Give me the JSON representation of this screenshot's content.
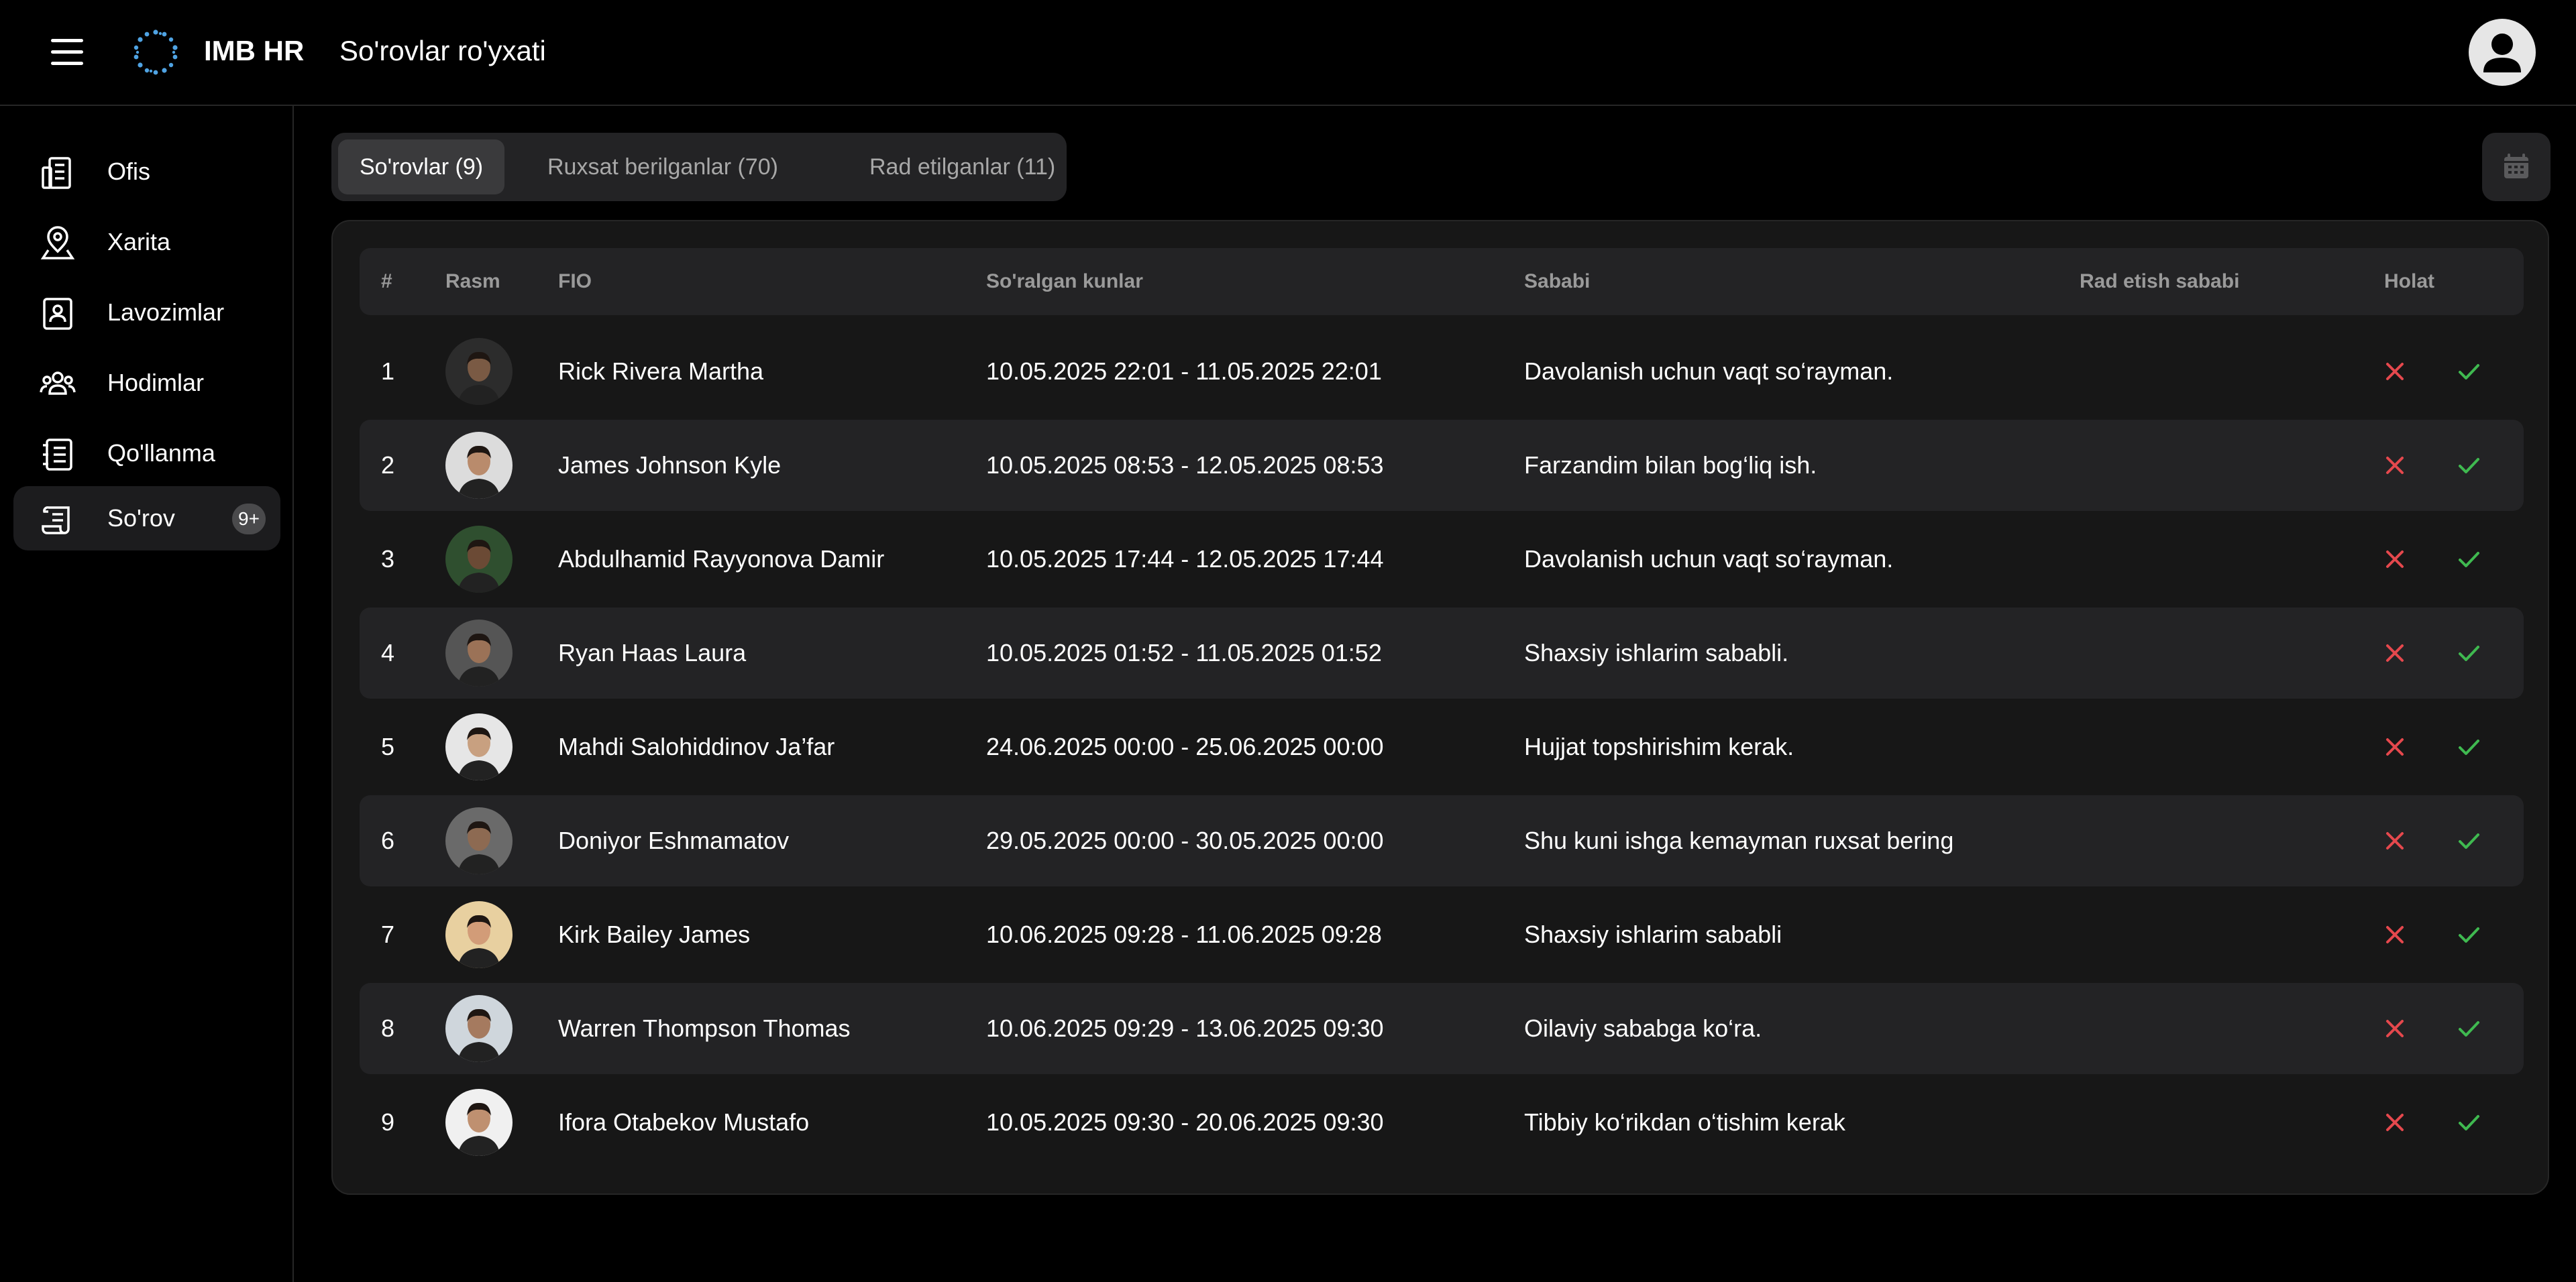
{
  "header": {
    "brand": "IMB HR",
    "title": "So'rovlar ro'yxati"
  },
  "sidebar": {
    "items": [
      {
        "label": "Ofis",
        "icon": "office-building-icon"
      },
      {
        "label": "Xarita",
        "icon": "map-pin-icon"
      },
      {
        "label": "Lavozimlar",
        "icon": "id-badge-icon"
      },
      {
        "label": "Hodimlar",
        "icon": "people-icon"
      },
      {
        "label": "Qo'llanma",
        "icon": "notebook-icon"
      },
      {
        "label": "So'rov",
        "icon": "scroll-icon",
        "badge": "9+",
        "active": true
      }
    ]
  },
  "tabs": [
    {
      "label": "So'rovlar (9)",
      "active": true
    },
    {
      "label": "Ruxsat berilganlar (70)",
      "active": false
    },
    {
      "label": "Rad etilganlar (11)",
      "active": false
    }
  ],
  "table": {
    "columns": {
      "num": "#",
      "photo": "Rasm",
      "name": "FIO",
      "dates": "So'ralgan kunlar",
      "reason": "Sababi",
      "reject_reason": "Rad etish sababi",
      "status": "Holat"
    },
    "rows": [
      {
        "num": "1",
        "name": "Rick Rivera Martha",
        "dates": "10.05.2025 22:01 - 11.05.2025 22:01",
        "reason": "Davolanish uchun vaqt so‘rayman.",
        "reject_reason": ""
      },
      {
        "num": "2",
        "name": "James Johnson Kyle",
        "dates": "10.05.2025 08:53 - 12.05.2025 08:53",
        "reason": "Farzandim bilan bog‘liq ish.",
        "reject_reason": ""
      },
      {
        "num": "3",
        "name": "Abdulhamid Rayyonova Damir",
        "dates": "10.05.2025 17:44 - 12.05.2025 17:44",
        "reason": "Davolanish uchun vaqt so‘rayman.",
        "reject_reason": ""
      },
      {
        "num": "4",
        "name": "Ryan Haas Laura",
        "dates": "10.05.2025 01:52 - 11.05.2025 01:52",
        "reason": "Shaxsiy ishlarim sababli.",
        "reject_reason": ""
      },
      {
        "num": "5",
        "name": "Mahdi Salohiddinov Ja’far",
        "dates": "24.06.2025 00:00 - 25.06.2025 00:00",
        "reason": "Hujjat topshirishim kerak.",
        "reject_reason": ""
      },
      {
        "num": "6",
        "name": "Doniyor Eshmamatov",
        "dates": "29.05.2025 00:00 - 30.05.2025 00:00",
        "reason": "Shu kuni ishga kemayman ruxsat bering",
        "reject_reason": ""
      },
      {
        "num": "7",
        "name": "Kirk Bailey James",
        "dates": "10.06.2025 09:28 - 11.06.2025 09:28",
        "reason": "Shaxsiy ishlarim sababli",
        "reject_reason": ""
      },
      {
        "num": "8",
        "name": "Warren Thompson Thomas",
        "dates": "10.06.2025 09:29 - 13.06.2025 09:30",
        "reason": "Oilaviy sababga ko‘ra.",
        "reject_reason": ""
      },
      {
        "num": "9",
        "name": "Ifora Otabekov Mustafo",
        "dates": "10.05.2025 09:30 - 20.06.2025 09:30",
        "reason": "Tibbiy ko‘rikdan o‘tishim kerak",
        "reject_reason": ""
      }
    ]
  },
  "colors": {
    "reject": "#e5484d",
    "approve": "#3fb950",
    "accent": "#4fa3e3"
  }
}
